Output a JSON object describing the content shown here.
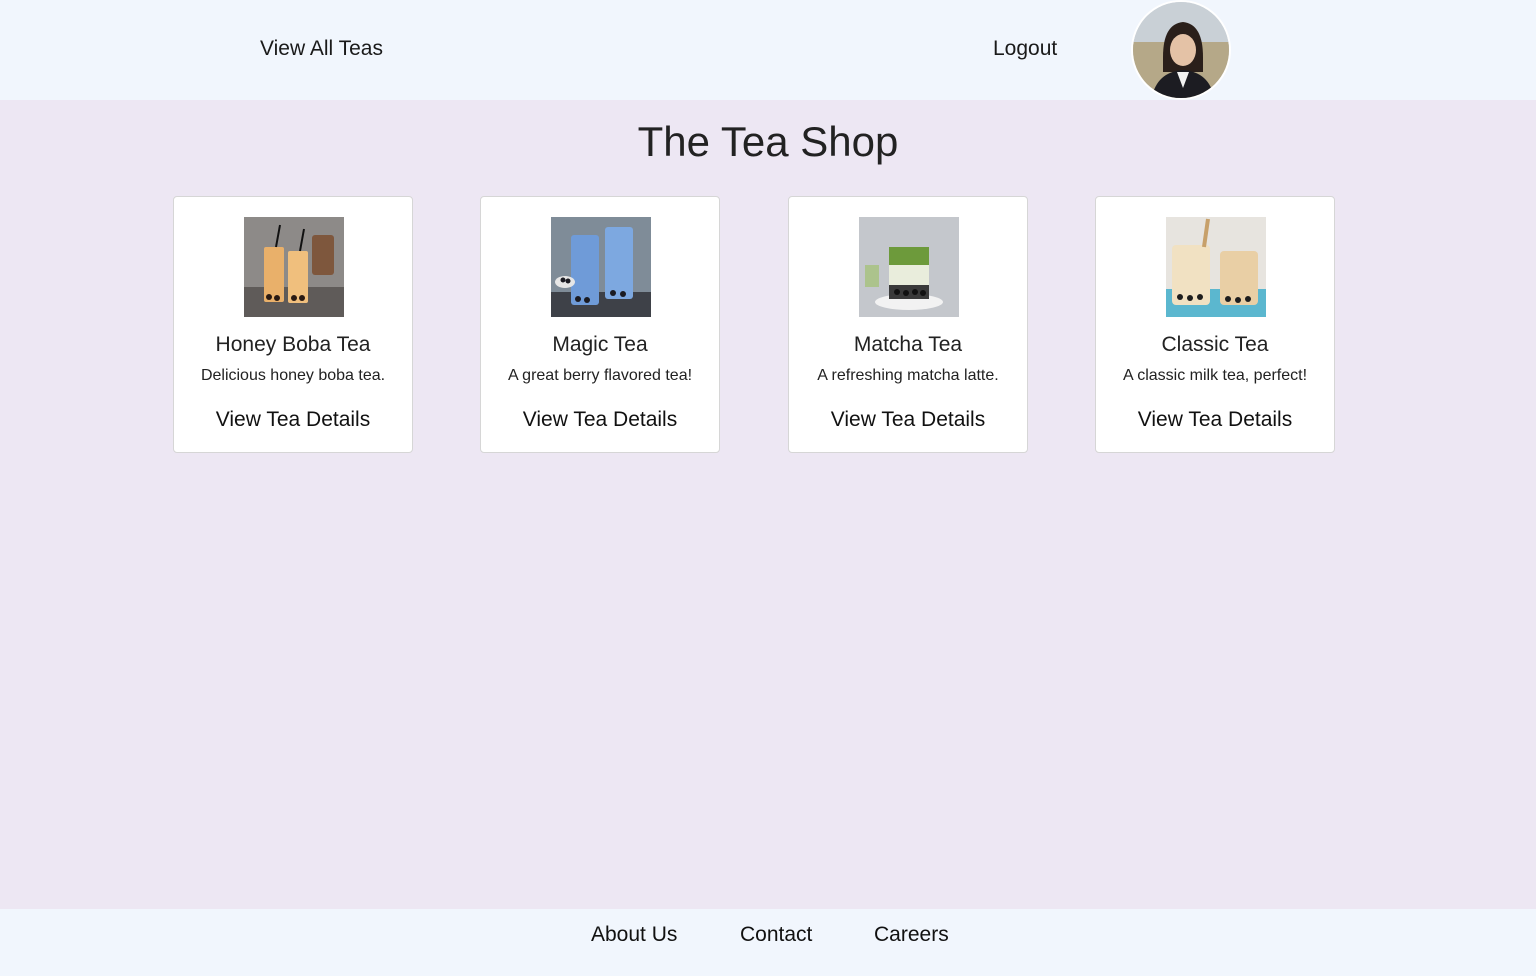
{
  "header": {
    "view_all_label": "View All Teas",
    "logout_label": "Logout",
    "avatar_icon": "user-avatar-photo"
  },
  "page": {
    "title": "The Tea Shop"
  },
  "teas": [
    {
      "name": "Honey Boba Tea",
      "description": "Delicious honey boba tea.",
      "link_label": "View Tea Details",
      "image": "honey-boba-tea-photo"
    },
    {
      "name": "Magic Tea",
      "description": "A great berry flavored tea!",
      "link_label": "View Tea Details",
      "image": "magic-tea-photo"
    },
    {
      "name": "Matcha Tea",
      "description": "A refreshing matcha latte.",
      "link_label": "View Tea Details",
      "image": "matcha-tea-photo"
    },
    {
      "name": "Classic Tea",
      "description": "A classic milk tea, perfect!",
      "link_label": "View Tea Details",
      "image": "classic-tea-photo"
    }
  ],
  "footer": {
    "about_label": "About Us",
    "contact_label": "Contact",
    "careers_label": "Careers"
  },
  "colors": {
    "page_background": "#ede7f3",
    "bar_background": "#f1f6fd",
    "card_background": "#ffffff"
  }
}
